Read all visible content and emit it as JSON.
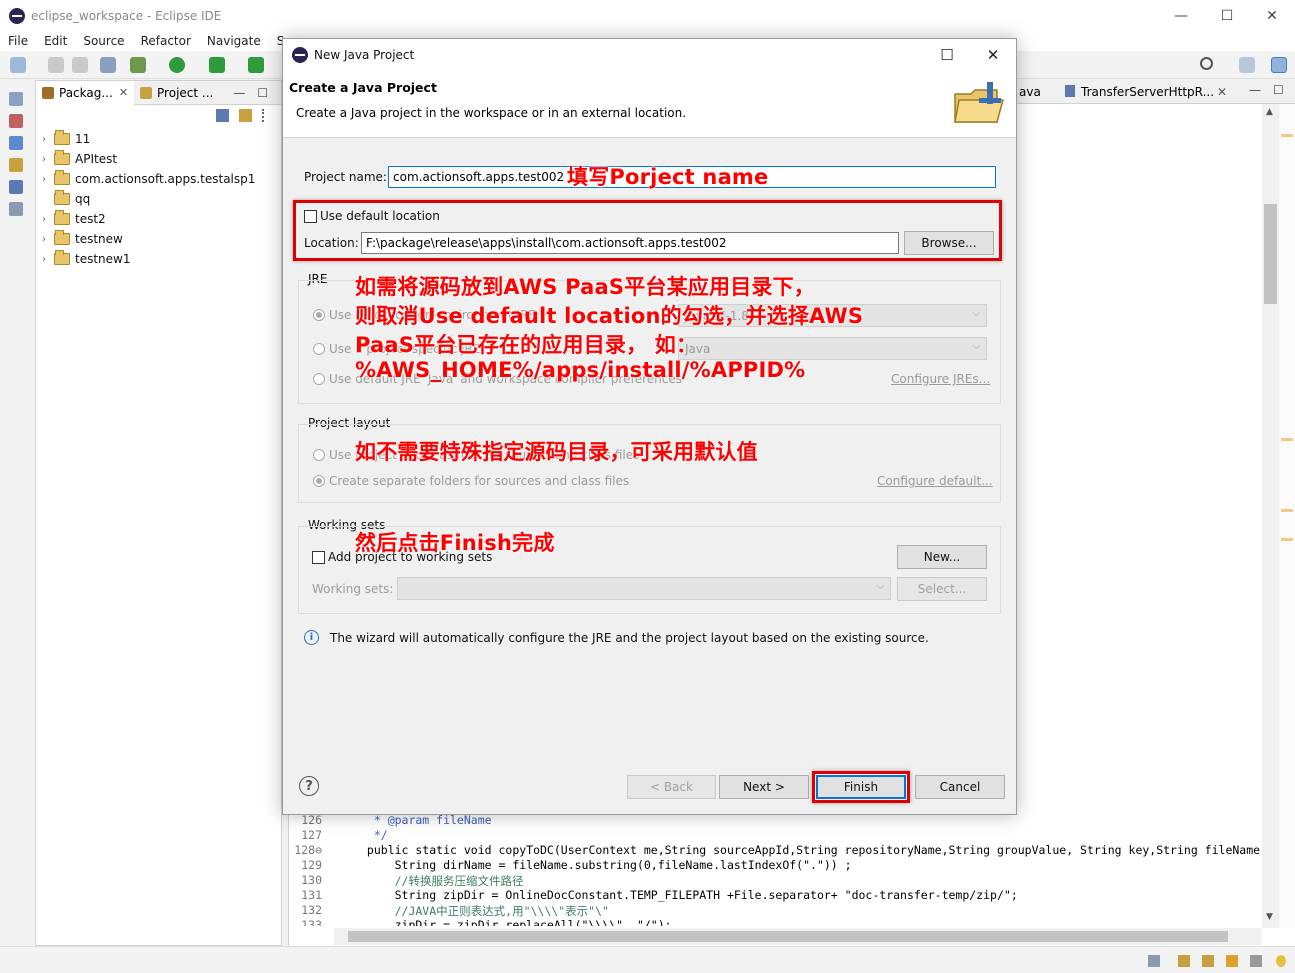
{
  "window": {
    "title": "eclipse_workspace - Eclipse IDE",
    "controls": {
      "minimize": "—",
      "maximize": "☐",
      "close": "✕"
    }
  },
  "menubar": {
    "items": [
      "File",
      "Edit",
      "Source",
      "Refactor",
      "Navigate",
      "Sea"
    ]
  },
  "package_explorer": {
    "tabs": [
      {
        "label": "Packag...",
        "close": "✕"
      },
      {
        "label": "Project ...",
        "close": ""
      }
    ],
    "items": [
      {
        "arrow": "›",
        "label": "11"
      },
      {
        "arrow": "›",
        "label": "APItest"
      },
      {
        "arrow": "›",
        "label": "com.actionsoft.apps.testalsp1"
      },
      {
        "arrow": "",
        "label": "qq"
      },
      {
        "arrow": "›",
        "label": "test2"
      },
      {
        "arrow": "›",
        "label": "testnew"
      },
      {
        "arrow": "›",
        "label": "testnew1"
      }
    ]
  },
  "editor": {
    "tabs": [
      {
        "label": "ava"
      },
      {
        "label": "TransferServerHttpR..."
      }
    ],
    "tab_close": "✕",
    "code_lines": [
      {
        "line": "126",
        "text": "  * @param fileName"
      },
      {
        "line": "127",
        "text": "  */"
      },
      {
        "line": "128⊖",
        "text": " public static void copyToDC(UserContext me,String sourceAppId,String repositoryName,String groupValue, String key,String fileName"
      },
      {
        "line": "129",
        "text": "     String dirName = fileName.substring(0,fileName.lastIndexOf(\".\")) ;"
      },
      {
        "line": "130",
        "text": "     //转换服务压缩文件路径"
      },
      {
        "line": "131",
        "text": "     String zipDir = OnlineDocConstant.TEMP_FILEPATH +File.separator+ \"doc-transfer-temp/zip/\";"
      },
      {
        "line": "132",
        "text": "     //JAVA中正则表达式,用\"\\\\\\\\\"表示\"\\\""
      },
      {
        "line": "133",
        "text": "     zipDir = zipDir.replaceAll(\"\\\\\\\\\", \"/\");"
      }
    ]
  },
  "dialog": {
    "title": "New Java Project",
    "controls": {
      "maximize": "☐",
      "close": "✕"
    },
    "header_title": "Create a Java Project",
    "header_desc": "Create a Java project in the workspace or in an external location.",
    "project_name_label": "Project name:",
    "project_name_value": "com.actionsoft.apps.test002",
    "use_default_location_label": "Use default location",
    "location_label": "Location:",
    "location_value": "F:\\package\\release\\apps\\install\\com.actionsoft.apps.test002",
    "browse_button": "Browse...",
    "jre_group": "JRE",
    "jre_option1": "Use an execution environment JRE:",
    "jre_option1_value": "JavaSE-1.8",
    "jre_option2": "Use a project specific JRE:",
    "jre_option2_value": "Java",
    "jre_option3": "Use default JRE 'Java' and workspace compiler preferences",
    "configure_jres": "Configure JREs...",
    "layout_group": "Project layout",
    "layout_option1": "Use project folder as root for sources and class files",
    "layout_option2": "Create separate folders for sources and class files",
    "configure_default": "Configure default...",
    "working_sets_group": "Working sets",
    "add_to_working_sets": "Add project to working sets",
    "new_button": "New...",
    "working_sets_label": "Working sets:",
    "select_button": "Select...",
    "info_text": "The wizard will automatically configure the JRE and the project layout based on the existing source.",
    "back_button": "< Back",
    "next_button": "Next >",
    "finish_button": "Finish",
    "cancel_button": "Cancel",
    "help_icon_text": "?",
    "info_icon_text": "i"
  },
  "annotations": {
    "name_note": "填写Porject name",
    "location_note_1": "如需将源码放到AWS PaaS平台某应用目录下，",
    "location_note_2": "则取消Use default location的勾选，并选择AWS",
    "location_note_3": "PaaS平台已存在的应用目录，  如：",
    "location_note_4": "%AWS_HOME%/apps/install/%APPID%",
    "layout_note": "如不需要特殊指定源码目录，可采用默认值",
    "finish_note": "然后点击Finish完成",
    "color": "#ff0000"
  }
}
